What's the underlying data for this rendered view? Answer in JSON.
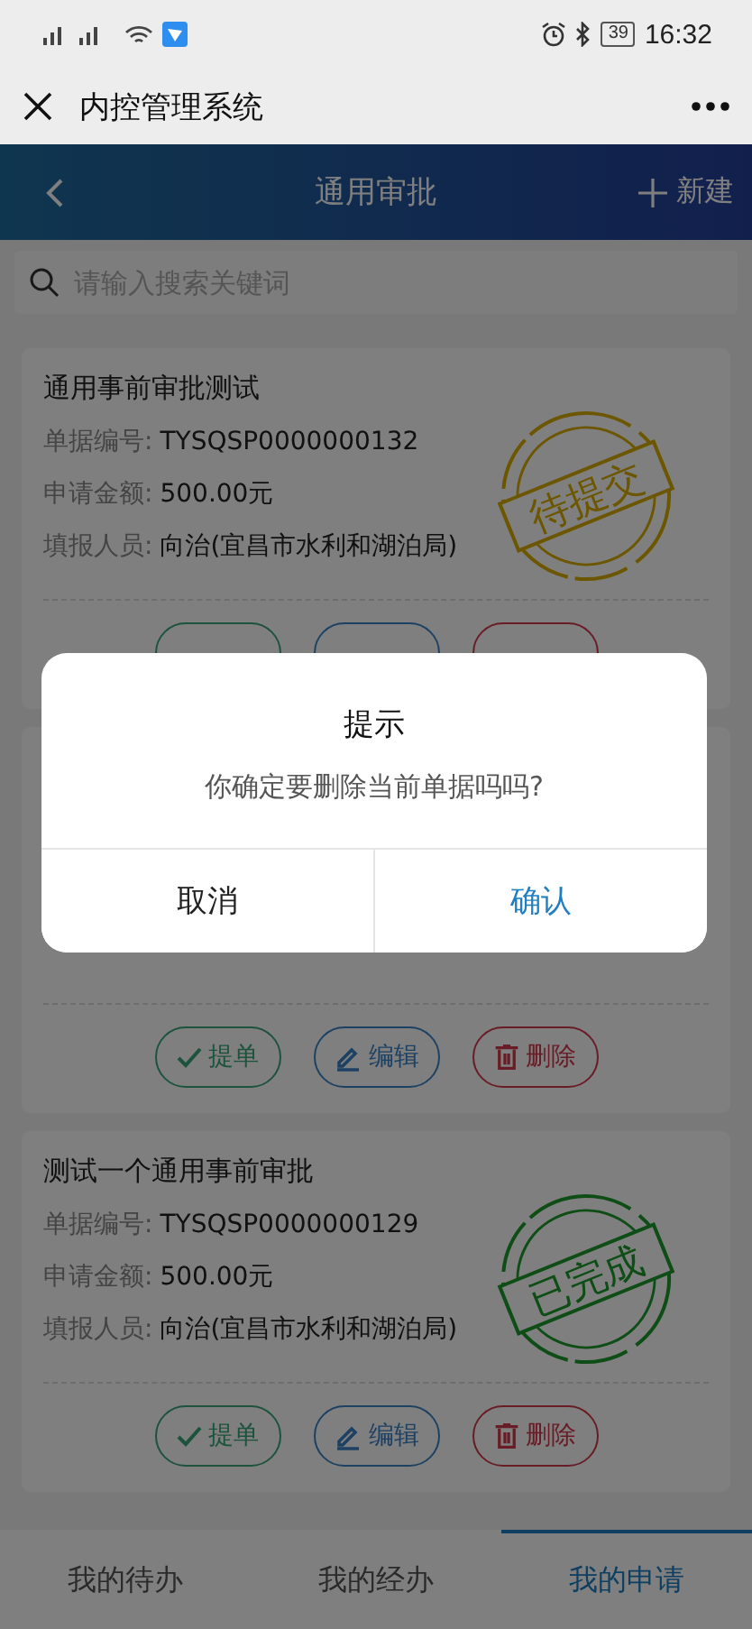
{
  "status_bar": {
    "time": "16:32",
    "battery": "39"
  },
  "wechat_bar": {
    "title": "内控管理系统"
  },
  "header": {
    "title": "通用审批",
    "action": "新建"
  },
  "search": {
    "placeholder": "请输入搜索关键词"
  },
  "cards": [
    {
      "title": "通用事前审批测试",
      "fields": [
        {
          "label": "单据编号:",
          "value": "TYSQSP0000000132"
        },
        {
          "label": "申请金额:",
          "value": "500.00元"
        },
        {
          "label": "填报人员:",
          "value": "向治(宜昌市水利和湖泊局)"
        }
      ],
      "stamp": {
        "text": "待提交",
        "kind": "pending"
      },
      "actions": [
        {
          "kind": "submit"
        },
        {
          "kind": "edit"
        },
        {
          "kind": "delete"
        }
      ]
    },
    {
      "actions": [
        {
          "kind": "submit",
          "label": "提单"
        },
        {
          "kind": "edit",
          "label": "编辑"
        },
        {
          "kind": "delete",
          "label": "删除"
        }
      ]
    },
    {
      "title": "测试一个通用事前审批",
      "fields": [
        {
          "label": "单据编号:",
          "value": "TYSQSP0000000129"
        },
        {
          "label": "申请金额:",
          "value": "500.00元"
        },
        {
          "label": "填报人员:",
          "value": "向治(宜昌市水利和湖泊局)"
        }
      ],
      "stamp": {
        "text": "已完成",
        "kind": "done"
      },
      "actions": [
        {
          "kind": "submit",
          "label": "提单"
        },
        {
          "kind": "edit",
          "label": "编辑"
        },
        {
          "kind": "delete",
          "label": "删除"
        }
      ]
    }
  ],
  "tabs": [
    {
      "label": "我的待办",
      "selected": false
    },
    {
      "label": "我的经办",
      "selected": false
    },
    {
      "label": "我的申请",
      "selected": true
    }
  ],
  "dialog": {
    "title": "提示",
    "message": "你确定要删除当前单据吗吗?",
    "buttons": [
      {
        "kind": "cancel",
        "label": "取消"
      },
      {
        "kind": "confirm",
        "label": "确认"
      }
    ]
  }
}
